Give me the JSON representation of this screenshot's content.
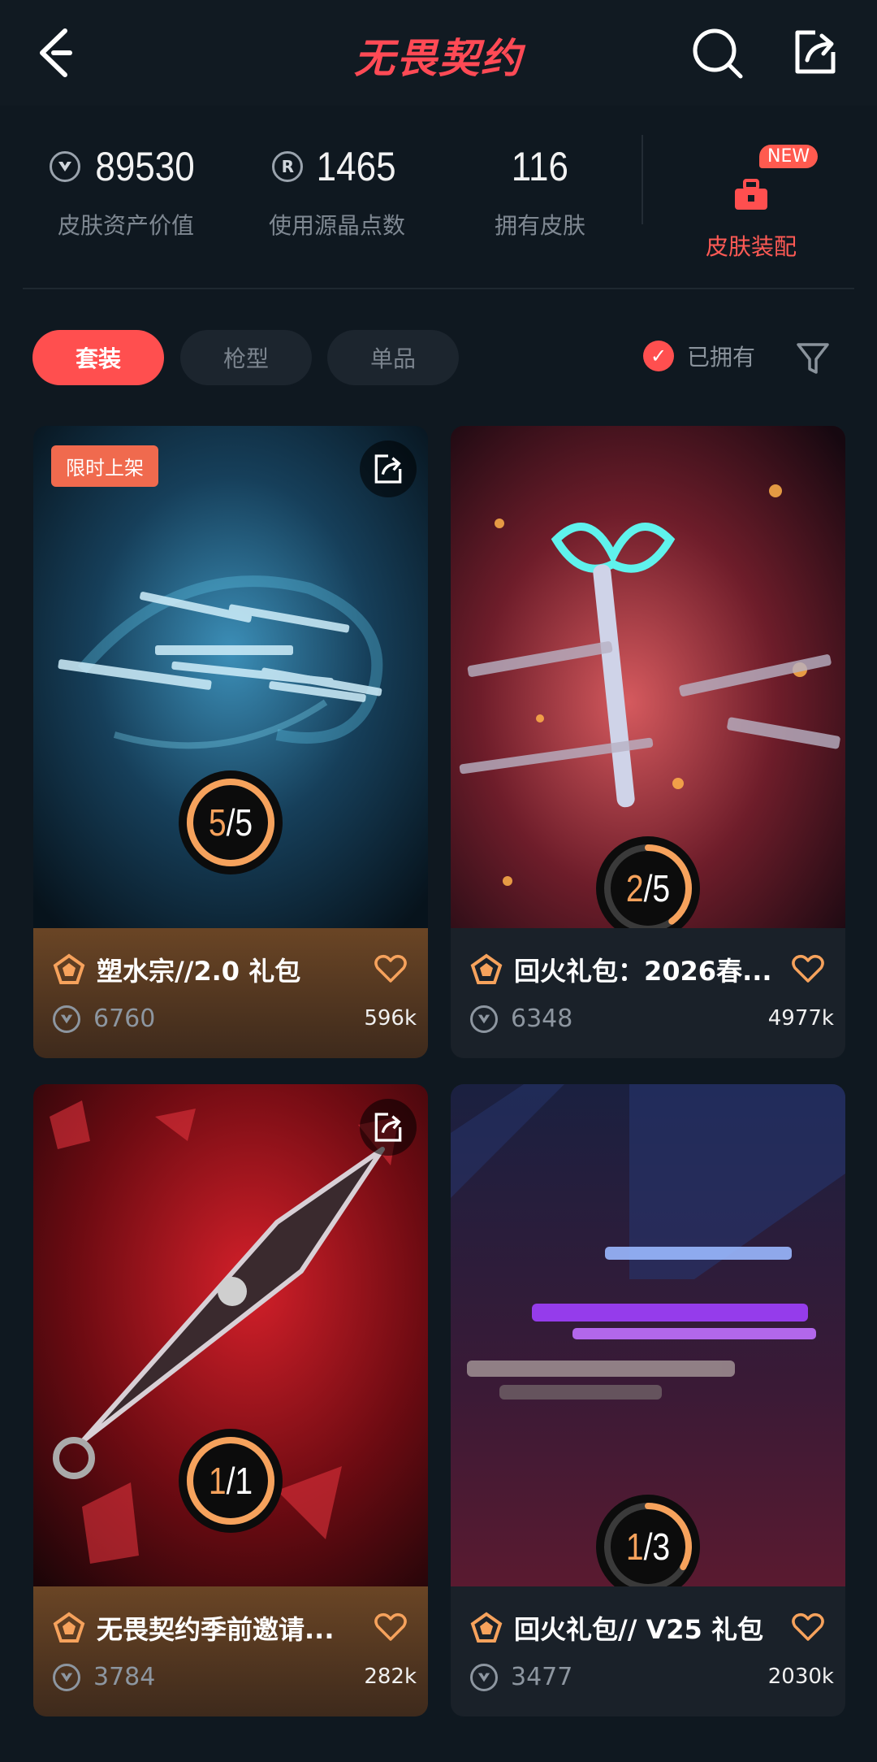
{
  "header": {
    "title": "无畏契约"
  },
  "stats": [
    {
      "value": "89530",
      "label": "皮肤资产价值",
      "icon": "vp-coin-icon"
    },
    {
      "value": "1465",
      "label": "使用源晶点数",
      "icon": "radianite-icon"
    },
    {
      "value": "116",
      "label": "拥有皮肤"
    }
  ],
  "equip": {
    "badge": "NEW",
    "label": "皮肤装配",
    "color": "#ff5a55"
  },
  "tabs": [
    {
      "label": "套装",
      "active": true
    },
    {
      "label": "枪型",
      "active": false
    },
    {
      "label": "单品",
      "active": false
    }
  ],
  "owned_filter": {
    "label": "已拥有",
    "checked": true
  },
  "coin_glyph": "R",
  "cards": [
    {
      "name": "塑水宗//2.0 礼包",
      "price": "6760",
      "likes": "596k",
      "owned": "5",
      "total": "5",
      "progress": 1.0,
      "limited": "限时上架",
      "theme": "blue-vortex"
    },
    {
      "name": "回火礼包：2026春...",
      "price": "6348",
      "likes": "4977k",
      "owned": "2",
      "total": "5",
      "progress": 0.4,
      "theme": "red-lantern"
    },
    {
      "name": "无畏契约季前邀请...",
      "price": "3784",
      "likes": "282k",
      "owned": "1",
      "total": "1",
      "progress": 1.0,
      "theme": "red-knife"
    },
    {
      "name": "回火礼包// V25 礼包",
      "price": "3477",
      "likes": "2030k",
      "owned": "1",
      "total": "3",
      "progress": 0.333,
      "theme": "purple-guns"
    }
  ],
  "colors": {
    "accent": "#ff4f4f",
    "progress": "#f6a25c",
    "background": "#0f1820"
  }
}
